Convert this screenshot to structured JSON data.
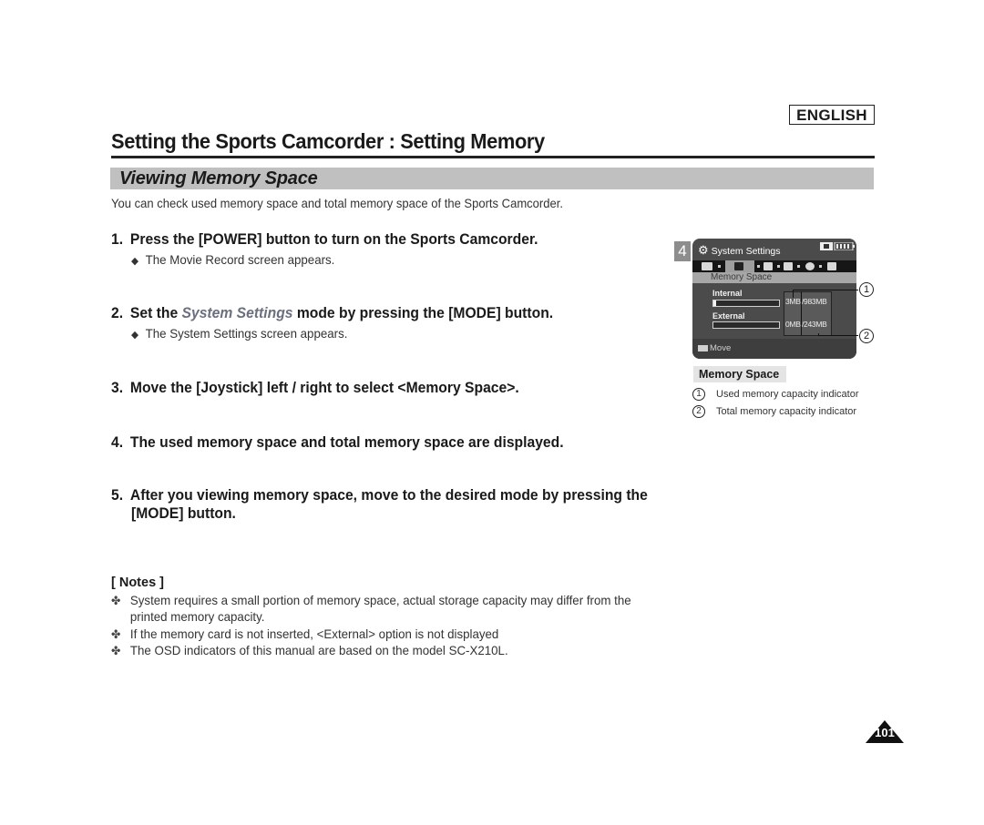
{
  "header": {
    "language": "ENGLISH",
    "page_title": "Setting the Sports Camcorder : Setting Memory"
  },
  "section": {
    "title": "Viewing Memory Space",
    "intro": "You can check used memory space and total memory space of the Sports Camcorder."
  },
  "steps": [
    {
      "num": "1.",
      "text": "Press the [POWER] button to turn on the Sports Camcorder.",
      "sub": "The Movie Record screen appears."
    },
    {
      "num": "2.",
      "pre": "Set the ",
      "em": "System Settings",
      "post": " mode by pressing the [MODE] button.",
      "sub": "The System Settings screen appears."
    },
    {
      "num": "3.",
      "text": "Move the [Joystick] left / right to select <Memory Space>."
    },
    {
      "num": "4.",
      "text": "The used memory space and total memory space are displayed."
    },
    {
      "num": "5.",
      "line1": "After you viewing memory space, move to the desired mode by pressing the",
      "line2": "[MODE] button."
    }
  ],
  "sub_bullet": "◆",
  "notes": {
    "heading": "[ Notes ]",
    "bullet": "✤",
    "items": [
      {
        "line1": "System requires a small portion of memory space, actual storage capacity may differ from the",
        "line2": "printed memory capacity."
      },
      {
        "line1": "If the memory card is not inserted, <External> option is not displayed"
      },
      {
        "line1": "The OSD indicators of this manual are based on the model SC-X210L."
      }
    ]
  },
  "camera_screen": {
    "step_tag": "4",
    "title": "System Settings",
    "gear_icon": "⚙",
    "subtitle": "Memory Space",
    "internal": {
      "label": "Internal",
      "used": "3MB",
      "total": "/983MB",
      "used_fraction": 0.03
    },
    "external": {
      "label": "External",
      "used": "0MB",
      "total": "/243MB",
      "used_fraction": 0.0
    },
    "footer": "Move",
    "callouts": [
      "1",
      "2"
    ]
  },
  "legend": {
    "title": "Memory Space",
    "items": [
      {
        "num": "1",
        "text": "Used memory capacity indicator"
      },
      {
        "num": "2",
        "text": "Total memory capacity indicator"
      }
    ]
  },
  "page_number": "101"
}
